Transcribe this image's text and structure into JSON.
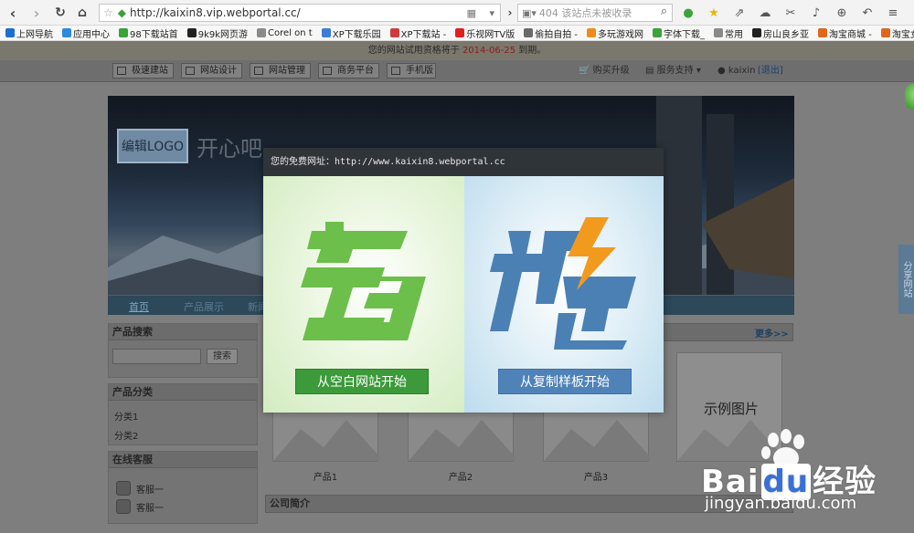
{
  "browser": {
    "url": "http://kaixin8.vip.webportal.cc/",
    "search_placeholder": "404  该站点未被收录"
  },
  "bookmarks": [
    {
      "label": "上网导航",
      "color": "#1c6fd1"
    },
    {
      "label": "应用中心",
      "color": "#2b8ae0"
    },
    {
      "label": "98下载站首",
      "color": "#3aa33a"
    },
    {
      "label": "9k9k网页游",
      "color": "#222222"
    },
    {
      "label": "Corel on t",
      "color": "#8a8a8a"
    },
    {
      "label": "XP下载乐园",
      "color": "#3a7fd5"
    },
    {
      "label": "XP下载站 -",
      "color": "#d03b3b"
    },
    {
      "label": "乐视网TV版",
      "color": "#e02020"
    },
    {
      "label": "偷拍自拍 -",
      "color": "#6a6a6a"
    },
    {
      "label": "多玩游戏网",
      "color": "#f08a1a"
    },
    {
      "label": "字体下载_",
      "color": "#3aa33a"
    },
    {
      "label": "常用",
      "color": "#8a8a8a"
    },
    {
      "label": "房山良乡亚",
      "color": "#222222"
    },
    {
      "label": "淘宝商城 -",
      "color": "#e0661a"
    },
    {
      "label": "淘宝女人频",
      "color": "#e0661a"
    }
  ],
  "notice": {
    "prefix": "您的网站试用资格将于",
    "date": "2014-06-25",
    "suffix": "到期。"
  },
  "admin": {
    "tabs": [
      "极速建站",
      "网站设计",
      "网站管理",
      "商务平台",
      "手机版"
    ],
    "buy": "购买升级",
    "support": "服务支持",
    "user": "kaixin",
    "logout": "[退出]"
  },
  "site": {
    "logo_label": "编辑LOGO",
    "name": "开心吧",
    "nav": [
      "首页",
      "产品展示",
      "新闻"
    ]
  },
  "sidebar": {
    "search_title": "产品搜索",
    "search_button": "搜索",
    "category_title": "产品分类",
    "categories": [
      "分类1",
      "分类2"
    ],
    "service_title": "在线客服",
    "services": [
      "客服一",
      "客服一"
    ]
  },
  "main": {
    "more": "更多>>",
    "products": [
      "产品1",
      "产品2",
      "产品3"
    ],
    "example_label": "示例图片",
    "intro_title": "公司简介"
  },
  "side_tab": "分享网站",
  "modal": {
    "header": "您的免费网址：http://www.kaixin8.webportal.cc",
    "left_art": "空白",
    "right_art": "极速",
    "left_button": "从空白网站开始",
    "right_button": "从复制样板开始"
  },
  "watermark": {
    "brand": "Bai",
    "brand2": "经验",
    "url": "jingyan.baidu.com"
  }
}
